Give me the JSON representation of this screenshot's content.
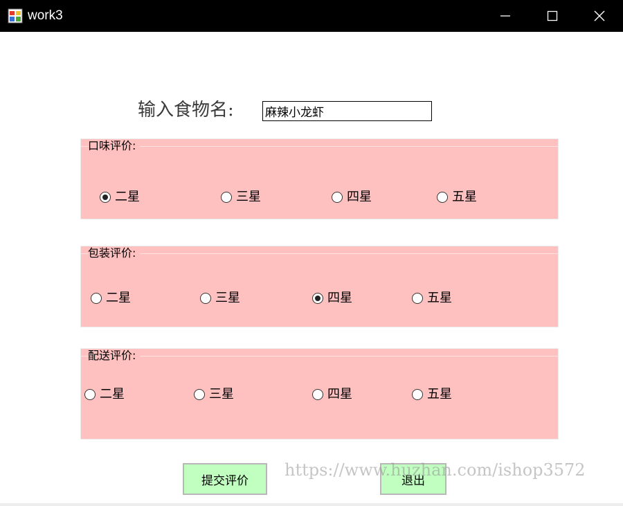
{
  "window": {
    "title": "work3",
    "icon": "app-window-icon",
    "controls": [
      "minimize-icon",
      "maximize-icon",
      "close-icon"
    ]
  },
  "food": {
    "label": "输入食物名:",
    "value": "麻辣小龙虾"
  },
  "groups": [
    {
      "title": "口味评价:",
      "options": [
        {
          "label": "二星",
          "checked": true
        },
        {
          "label": "三星",
          "checked": false
        },
        {
          "label": "四星",
          "checked": false
        },
        {
          "label": "五星",
          "checked": false
        }
      ]
    },
    {
      "title": "包装评价:",
      "options": [
        {
          "label": "二星",
          "checked": false
        },
        {
          "label": "三星",
          "checked": false
        },
        {
          "label": "四星",
          "checked": true
        },
        {
          "label": "五星",
          "checked": false
        }
      ]
    },
    {
      "title": "配送评价:",
      "options": [
        {
          "label": "二星",
          "checked": false
        },
        {
          "label": "三星",
          "checked": false
        },
        {
          "label": "四星",
          "checked": false
        },
        {
          "label": "五星",
          "checked": false
        }
      ]
    }
  ],
  "buttons": {
    "submit": "提交评价",
    "exit": "退出"
  },
  "watermark": "https://www.huzhan.com/ishop3572",
  "colors": {
    "group_background": "#ffc0c0",
    "button_background": "#c0ffc0",
    "titlebar": "#000000"
  }
}
